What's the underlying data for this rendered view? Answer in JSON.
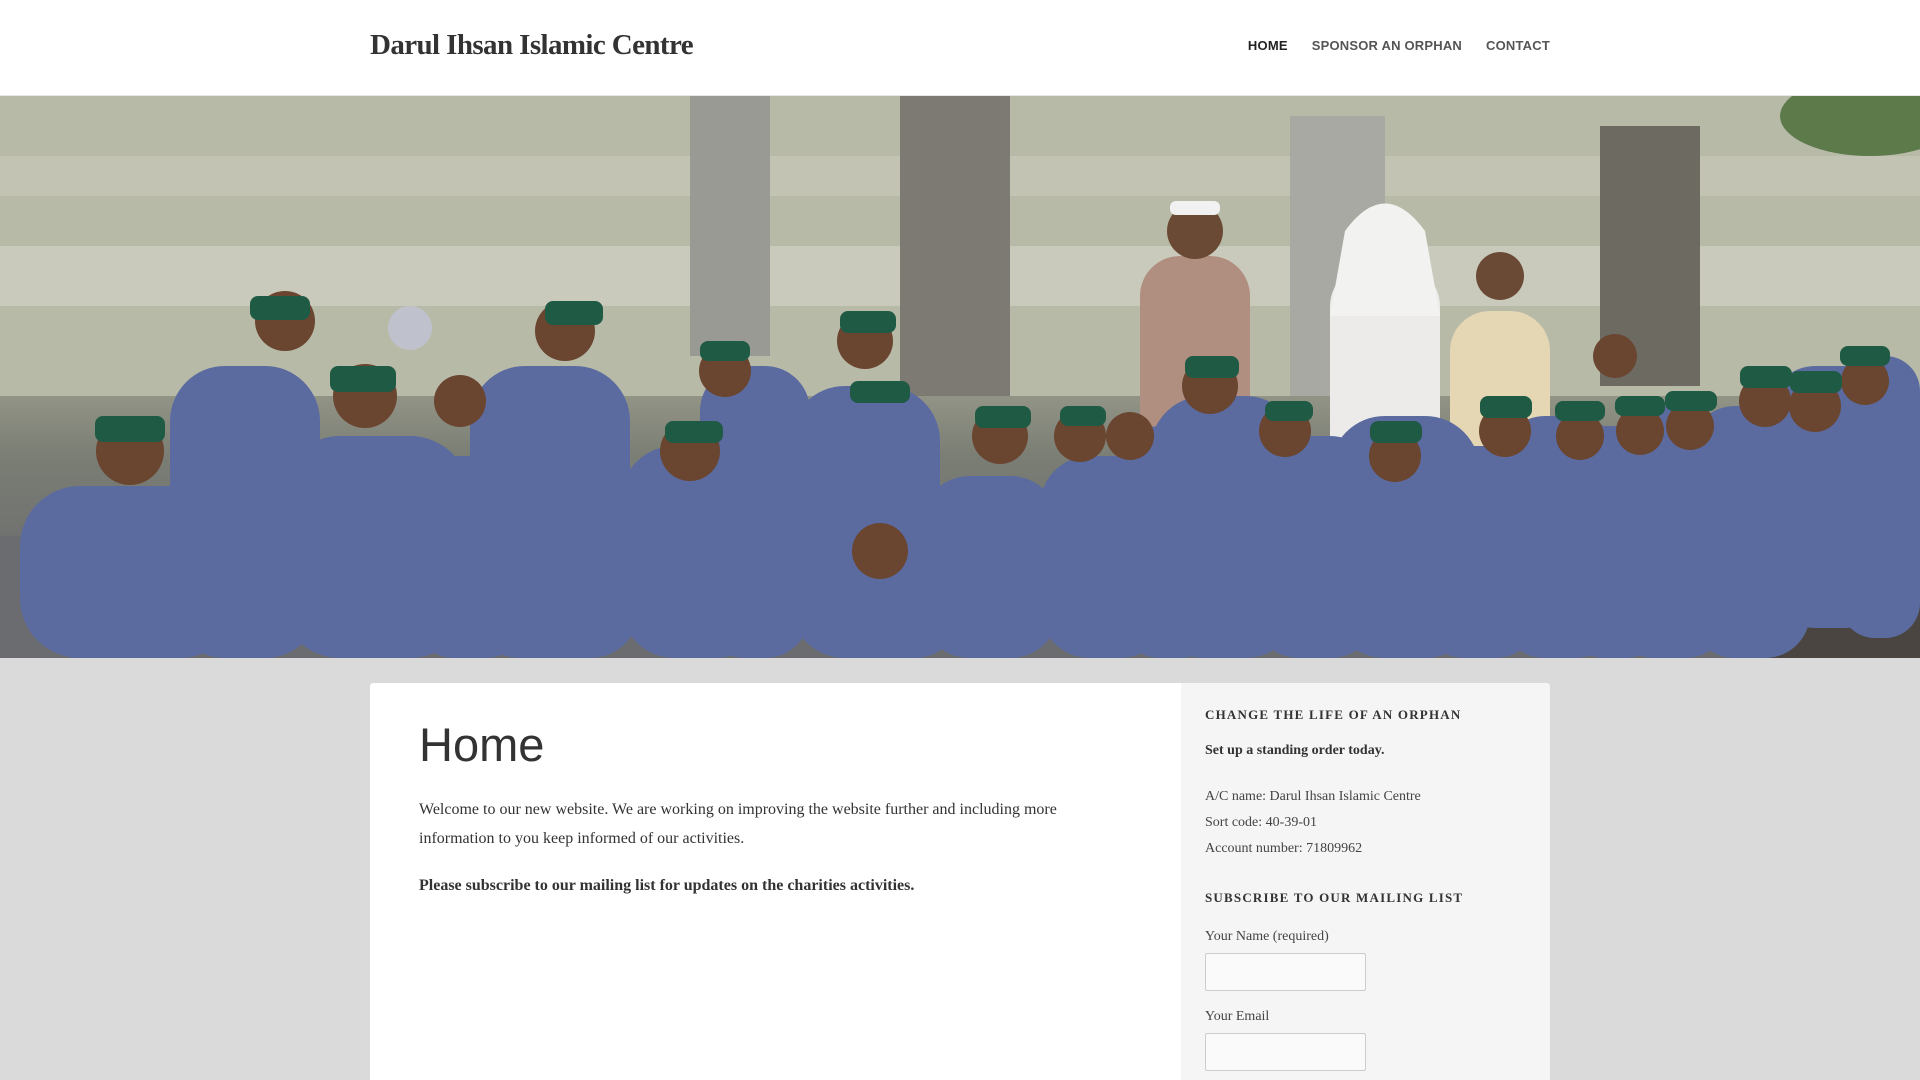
{
  "header": {
    "site_title": "Darul Ihsan Islamic Centre",
    "nav": [
      {
        "label": "HOME",
        "active": true
      },
      {
        "label": "SPONSOR AN ORPHAN",
        "active": false
      },
      {
        "label": "CONTACT",
        "active": false
      }
    ]
  },
  "hero": {
    "image_description": "group photo"
  },
  "main": {
    "title": "Home",
    "intro": "Welcome to our new website. We are working on improving the website further and including more information to you keep informed of our activities.",
    "subscribe_note": "Please subscribe to our mailing list for updates on the charities activities."
  },
  "sidebar": {
    "orphan_widget": {
      "title": "CHANGE THE LIFE OF AN ORPHAN",
      "cta": "Set up a standing order today.",
      "account_name": "A/C name: Darul Ihsan Islamic Centre",
      "sort_code": "Sort code: 40-39-01",
      "account_number": "Account number: 71809962"
    },
    "mailing_widget": {
      "title": "SUBSCRIBE TO OUR MAILING LIST",
      "name_label": "Your Name (required)",
      "name_value": "",
      "email_label": "Your Email",
      "email_value": ""
    }
  },
  "colors": {
    "background": "#dadada",
    "robe": "#5b6ba0",
    "cap": "#1f5a44",
    "text": "#333333"
  }
}
